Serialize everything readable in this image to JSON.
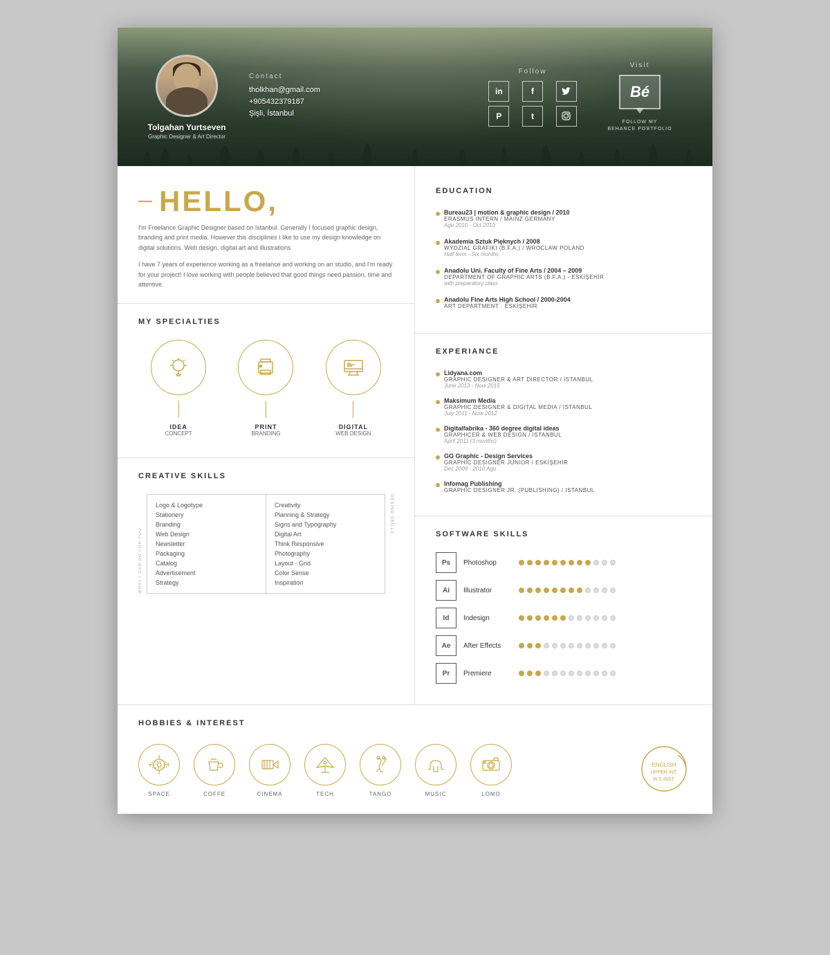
{
  "header": {
    "name": "Tolgahan Yurtseven",
    "title": "Graphic Designer & Art Director",
    "contact_label": "Contact",
    "email": "tholkhan@gmail.com",
    "phone": "+905432379187",
    "location": "Şişli, İstanbul",
    "follow_label": "Follow",
    "visit_label": "Visit",
    "behance_label": "FOLLOW MY\nBEHANCE PORTFOLIO",
    "social": [
      "in",
      "f",
      "🐦",
      "℗",
      "t",
      "📷"
    ]
  },
  "hello": {
    "title": "HELLO,",
    "dash": "—",
    "bio1": "I'm Freelance Graphic Designer based on Istanbul. Generally I focused graphic design, branding and print media. However this disciplines I like to use my design knowledge on digital solutions. Web design, digital art and illustrations",
    "bio2": "I have 7 years of experience working as a freelance and working on an studio, and I'm ready for your project! I love working with people believed that good things need passion, time and attentive."
  },
  "specialties": {
    "title": "MY SPECIALTIES",
    "items": [
      {
        "name": "IDEA",
        "sub": "CONCEPT"
      },
      {
        "name": "PRINT",
        "sub": "BRANDING"
      },
      {
        "name": "DIGITAL",
        "sub": "WEB DESIGN"
      }
    ]
  },
  "creative_skills": {
    "title": "CREATIVE SKILLS",
    "left_label": "WHAT I CAN DO FOR YOU",
    "right_label": "DESING SKILLS",
    "left_items": [
      "Logo & Logotype",
      "Stationery",
      "Branding",
      "Web Design",
      "Newsletter",
      "Packaging",
      "Catalog",
      "Advertisement",
      "Strategy"
    ],
    "right_items": [
      "Creativity",
      "Planning & Strategy",
      "Signs and Typography",
      "Digital Art",
      "Think Responsive",
      "Photography",
      "Layout - Grid",
      "Color Sense",
      "Inspiration"
    ]
  },
  "education": {
    "title": "EDUCATION",
    "items": [
      {
        "title": "Bureau23 | motion & graphic design / 2010",
        "subtitle": "ERASMUS INTERN / MAINZ GERMANY",
        "date": "Agu 2010 - Oct 2010"
      },
      {
        "title": "Akademia Sztuk Pięknych / 2008",
        "subtitle": "WYDZIAL GRAFIKI (B.F.A.) / WROCLAW POLAND",
        "date": "Half term - Six months"
      },
      {
        "title": "Anadolu Uni. Faculty of Fine Arts / 2004 – 2009",
        "subtitle": "DEPARTMENT OF GRAPHIC ARTS (B.F.A.) - ESKİŞEHİR",
        "date": "with preparatory class"
      },
      {
        "title": "Anadolu Fine Arts High School / 2000-2004",
        "subtitle": "ART DEPARTMENT · ESKİŞEHİR",
        "date": ""
      }
    ]
  },
  "experience": {
    "title": "EXPERIANCE",
    "items": [
      {
        "company": "Lidyana.com",
        "role": "GRAPHIC DESIGNER & ART DIRECTOR / ISTANBUL",
        "date": "June 2013 - Now 2015"
      },
      {
        "company": "Maksimum Media",
        "role": "GRAPHIC DESIGNER & DIGITAL MEDIA / ISTANBUL",
        "date": "July 2011 - Now 2012"
      },
      {
        "company": "Digitalfabrika - 360 degree digital ideas",
        "role": "GRAPHICER & WEB DESIGN / ISTANBUL",
        "date": "April 2011 (3 months)"
      },
      {
        "company": "GG Graphic - Design Services",
        "role": "GRAPHIC DESIGNER JUNIOR / ESKİŞEHİR",
        "date": "Dec 2009 - 2010 Agu"
      },
      {
        "company": "Infomag Publishing",
        "role": "GRAPHIC DESIGNER JR. (PUBLISHING) / ISTANBUL",
        "date": ""
      }
    ]
  },
  "software_skills": {
    "title": "SOFTWARE SKILLS",
    "items": [
      {
        "abbr": "Ps",
        "name": "Photoshop",
        "filled": 9,
        "empty": 3
      },
      {
        "abbr": "Ai",
        "name": "Illustrator",
        "filled": 8,
        "empty": 4
      },
      {
        "abbr": "Id",
        "name": "Indesign",
        "filled": 6,
        "empty": 6
      },
      {
        "abbr": "Ae",
        "name": "After Effects",
        "filled": 3,
        "empty": 9
      },
      {
        "abbr": "Pr",
        "name": "Premiere",
        "filled": 3,
        "empty": 9
      }
    ]
  },
  "hobbies": {
    "title": "HOBBIES & INTEREST",
    "items": [
      {
        "label": "SPACE"
      },
      {
        "label": "COFFE"
      },
      {
        "label": "CINEMA"
      },
      {
        "label": "TECH"
      },
      {
        "label": "TANGO"
      },
      {
        "label": "MUSIC"
      },
      {
        "label": "LOMO"
      }
    ],
    "language": {
      "line1": "ENGLISH",
      "line2": "UPPER INT.",
      "line3": "W.S.INST."
    }
  }
}
